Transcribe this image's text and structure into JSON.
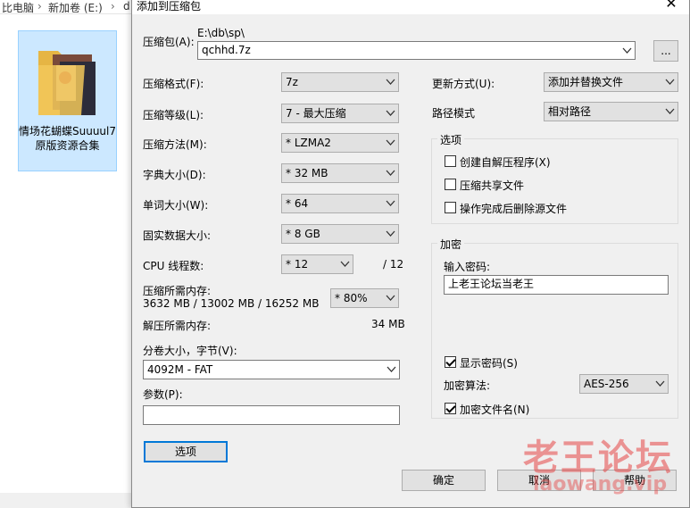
{
  "explorer": {
    "breadcrumb_1": "比电脑",
    "breadcrumb_2": "新加卷 (E:)",
    "breadcrumb_3": "d",
    "folder_name": "情场花蝴蝶Suuuul7 原版资源合集"
  },
  "dialog": {
    "title": "添加到压缩包",
    "archive_label": "压缩包(A):",
    "archive_path": "E:\\db\\sp\\",
    "archive_name": "qchhd.7z",
    "browse_label": "...",
    "format_label": "压缩格式(F):",
    "format_value": "7z",
    "level_label": "压缩等级(L):",
    "level_value": "7 - 最大压缩",
    "method_label": "压缩方法(M):",
    "method_value": "* LZMA2",
    "dict_label": "字典大小(D):",
    "dict_value": "* 32 MB",
    "word_label": "单词大小(W):",
    "word_value": "* 64",
    "solid_label": "固实数据大小:",
    "solid_value": "* 8 GB",
    "threads_label": "CPU 线程数:",
    "threads_value": "* 12",
    "threads_total": "/ 12",
    "mem_comp_label": "压缩所需内存:",
    "mem_comp_value": "3632 MB / 13002 MB / 16252 MB",
    "mem_percent": "* 80%",
    "mem_decomp_label": "解压所需内存:",
    "mem_decomp_value": "34 MB",
    "split_label": "分卷大小，字节(V):",
    "split_value": "4092M - FAT",
    "params_label": "参数(P):",
    "params_value": "",
    "options_button": "选项",
    "update_label": "更新方式(U):",
    "update_value": "添加并替换文件",
    "path_label": "路径模式",
    "path_value": "相对路径",
    "options_group": "选项",
    "opt_sfx": "创建自解压程序(X)",
    "opt_shared": "压缩共享文件",
    "opt_delete": "操作完成后删除源文件",
    "encrypt_group": "加密",
    "password_label": "输入密码:",
    "password_value": "上老王论坛当老王",
    "show_password": "显示密码(S)",
    "enc_method_label": "加密算法:",
    "enc_method_value": "AES-256",
    "enc_names": "加密文件名(N)",
    "ok": "确定",
    "cancel": "取消",
    "help": "帮助"
  },
  "watermark": {
    "cn": "老王论坛",
    "en": "laowang.vip"
  }
}
